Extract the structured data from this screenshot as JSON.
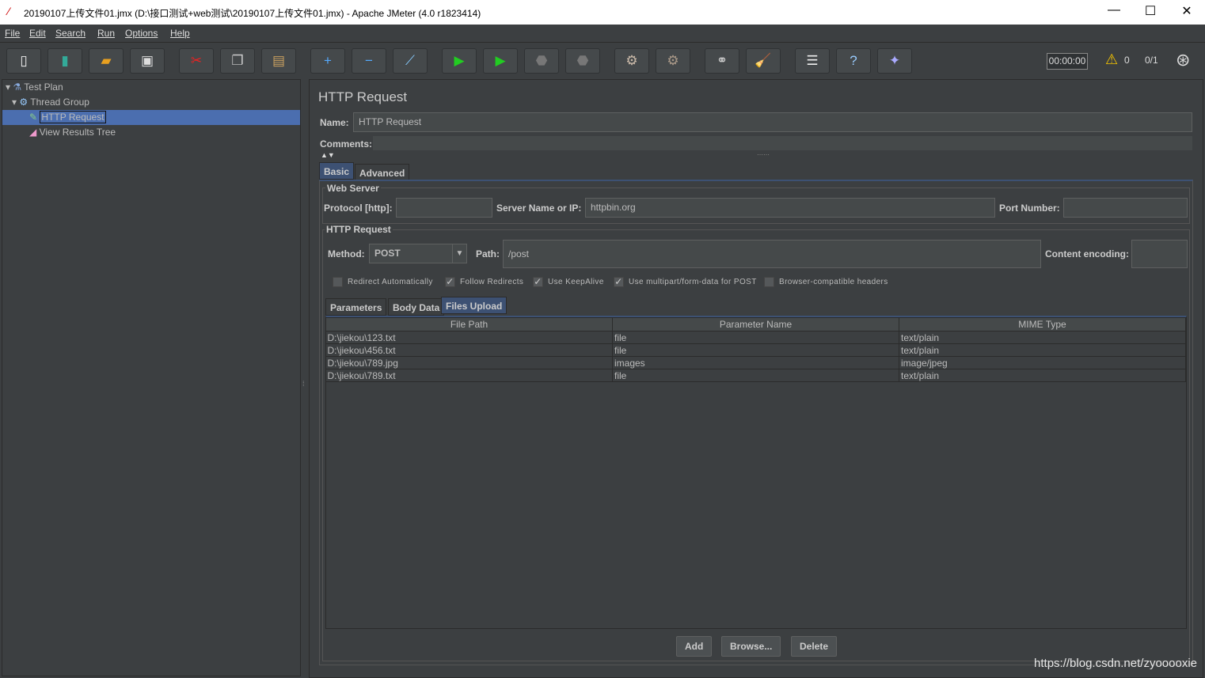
{
  "window": {
    "title": "20190107上传文件01.jmx (D:\\接口测试+web测试\\20190107上传文件01.jmx) - Apache JMeter (4.0 r1823414)",
    "controls": [
      "—",
      "☐",
      "✕"
    ]
  },
  "menu": [
    "File",
    "Edit",
    "Search",
    "Run",
    "Options",
    "Help"
  ],
  "toolbar": {
    "buttons": [
      {
        "icon": "new-icon",
        "glyph": "▯",
        "color": "#eee"
      },
      {
        "icon": "templates-icon",
        "glyph": "▮",
        "color": "#3a9"
      },
      {
        "icon": "open-icon",
        "glyph": "▰",
        "color": "#e8a020"
      },
      {
        "icon": "save-icon",
        "glyph": "▣",
        "color": "#ddd"
      },
      {
        "icon": "cut-icon",
        "glyph": "✂",
        "color": "#e22"
      },
      {
        "icon": "copy-icon",
        "glyph": "❐",
        "color": "#ccc"
      },
      {
        "icon": "paste-icon",
        "glyph": "▤",
        "color": "#c9a060"
      },
      {
        "icon": "expand-icon",
        "glyph": "+",
        "color": "#5af"
      },
      {
        "icon": "collapse-icon",
        "glyph": "−",
        "color": "#5af"
      },
      {
        "icon": "toggle-icon",
        "glyph": "⟋",
        "color": "#8cf"
      },
      {
        "icon": "start-icon",
        "glyph": "▶",
        "color": "#2c2"
      },
      {
        "icon": "start-no-pauses-icon",
        "glyph": "▶",
        "color": "#2c2"
      },
      {
        "icon": "stop-icon",
        "glyph": "⬣",
        "color": "#777"
      },
      {
        "icon": "shutdown-icon",
        "glyph": "⬣",
        "color": "#777"
      },
      {
        "icon": "clear-icon",
        "glyph": "⚙",
        "color": "#cba"
      },
      {
        "icon": "clear-all-icon",
        "glyph": "⚙",
        "color": "#a98"
      },
      {
        "icon": "search-icon",
        "glyph": "⚭",
        "color": "#ccc"
      },
      {
        "icon": "reset-search-icon",
        "glyph": "🧹",
        "color": "#fc0"
      },
      {
        "icon": "function-helper-icon",
        "glyph": "☰",
        "color": "#eee"
      },
      {
        "icon": "help-icon",
        "glyph": "?",
        "color": "#9cf"
      },
      {
        "icon": "remote-icon",
        "glyph": "✦",
        "color": "#aaf"
      }
    ],
    "timer": "00:00:00",
    "warnings": "0",
    "threads": "0/1"
  },
  "tree": [
    {
      "label": "Test Plan",
      "icon": "test-plan-icon"
    },
    {
      "label": "Thread Group",
      "icon": "thread-group-icon"
    },
    {
      "label": "HTTP Request",
      "icon": "http-sampler-icon",
      "selected": true
    },
    {
      "label": "View Results Tree",
      "icon": "results-tree-icon"
    }
  ],
  "panel": {
    "title": "HTTP Request",
    "name_label": "Name:",
    "name_value": "HTTP Request",
    "comments_label": "Comments:",
    "tabs": [
      "Basic",
      "Advanced"
    ],
    "web_server": {
      "legend": "Web Server",
      "protocol_label": "Protocol [http]:",
      "protocol_value": "",
      "server_label": "Server Name or IP:",
      "server_value": "httpbin.org",
      "port_label": "Port Number:",
      "port_value": ""
    },
    "http_request": {
      "legend": "HTTP Request",
      "method_label": "Method:",
      "method_value": "POST",
      "path_label": "Path:",
      "path_value": "/post",
      "encoding_label": "Content encoding:",
      "encoding_value": ""
    },
    "checkboxes": [
      {
        "label": "Redirect Automatically",
        "checked": false
      },
      {
        "label": "Follow Redirects",
        "checked": true
      },
      {
        "label": "Use KeepAlive",
        "checked": true
      },
      {
        "label": "Use multipart/form-data for POST",
        "checked": true
      },
      {
        "label": "Browser-compatible headers",
        "checked": false
      }
    ],
    "subtabs": [
      "Parameters",
      "Body Data",
      "Files Upload"
    ],
    "files": {
      "headers": [
        "File Path",
        "Parameter Name",
        "MIME Type"
      ],
      "rows": [
        [
          "D:\\jiekou\\123.txt",
          "file",
          "text/plain"
        ],
        [
          "D:\\jiekou\\456.txt",
          "file",
          "text/plain"
        ],
        [
          "D:\\jiekou\\789.jpg",
          "images",
          "image/jpeg"
        ],
        [
          "D:\\jiekou\\789.txt",
          "file",
          "text/plain"
        ]
      ]
    },
    "buttons": {
      "add": "Add",
      "browse": "Browse...",
      "delete": "Delete"
    }
  },
  "watermark": "https://blog.csdn.net/zyooooxie"
}
